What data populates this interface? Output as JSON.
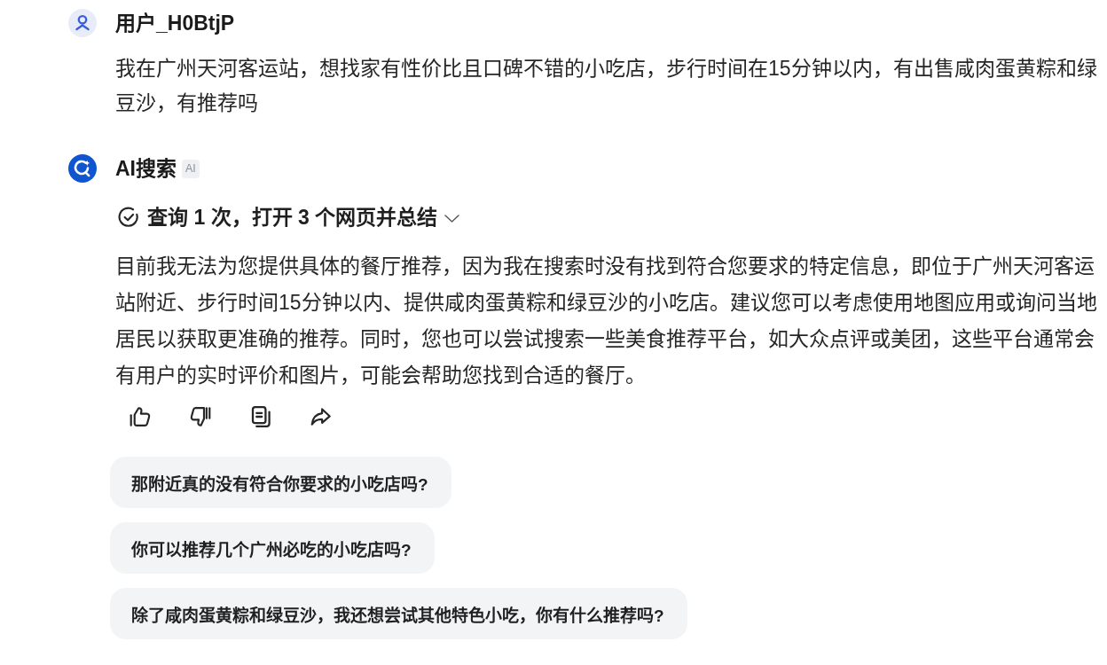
{
  "messages": [
    {
      "kind": "user",
      "author": "用户_H0BtjP",
      "text": "我在广州天河客运站，想找家有性价比且口碑不错的小吃店，步行时间在15分钟以内，有出售咸肉蛋黄粽和绿豆沙，有推荐吗"
    },
    {
      "kind": "assistant",
      "author": "AI搜索",
      "badge": "AI",
      "search_summary": {
        "text": "查询 1 次，打开 3 个网页并总结",
        "expanded": false
      },
      "text": "目前我无法为您提供具体的餐厅推荐，因为我在搜索时没有找到符合您要求的特定信息，即位于广州天河客运站附近、步行时间15分钟以内、提供咸肉蛋黄粽和绿豆沙的小吃店。建议您可以考虑使用地图应用或询问当地居民以获取更准确的推荐。同时，您也可以尝试搜索一些美食推荐平台，如大众点评或美团，这些平台通常会有用户的实时评价和图片，可能会帮助您找到合适的餐厅。",
      "suggestions": [
        "那附近真的没有符合你要求的小吃店吗?",
        "你可以推荐几个广州必吃的小吃店吗?",
        "除了咸肉蛋黄粽和绿豆沙，我还想尝试其他特色小吃，你有什么推荐吗?"
      ]
    }
  ]
}
